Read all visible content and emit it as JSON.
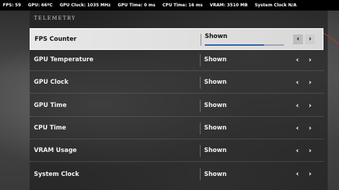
{
  "hud": [
    "FPS: 59",
    "GPU: 66ºC",
    "GPU Clock: 1035 MHz",
    "GPU Time: 0 ms",
    "CPU Time: 16 ms",
    "VRAM: 3510 MB",
    "System Clock N/A"
  ],
  "section_title": "TELEMETRY",
  "rows": [
    {
      "label": "FPS Counter",
      "value": "Shown"
    },
    {
      "label": "GPU Temperature",
      "value": "Shown"
    },
    {
      "label": "GPU Clock",
      "value": "Shown"
    },
    {
      "label": "GPU Time",
      "value": "Shown"
    },
    {
      "label": "CPU Time",
      "value": "Shown"
    },
    {
      "label": "VRAM Usage",
      "value": "Shown"
    },
    {
      "label": "System Clock",
      "value": "Shown"
    }
  ],
  "arrows": {
    "left": "‹",
    "right": "›"
  },
  "selected_progress": 0.75,
  "colors": {
    "hud_bg": "#000000",
    "selected_bg": "#e8e8e8",
    "progress_fill": "#2d5fa8"
  }
}
